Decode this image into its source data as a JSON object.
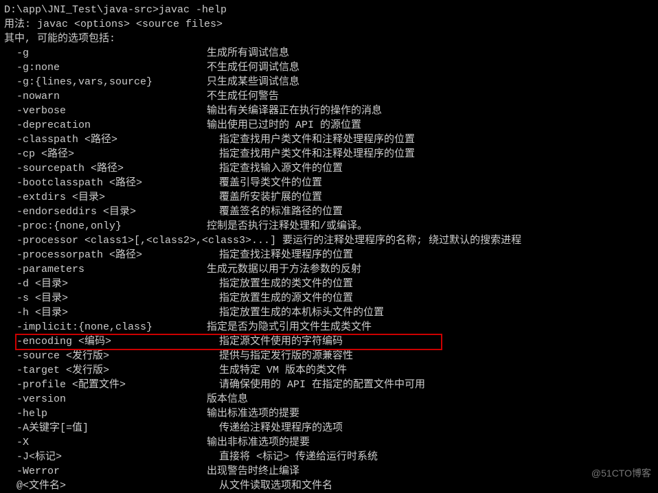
{
  "prompt": "D:\\app\\JNI_Test\\java-src>javac -help",
  "usage": "用法: javac <options> <source files>",
  "possible": "其中, 可能的选项包括:",
  "options": [
    {
      "flag": "  -g",
      "desc": "生成所有调试信息"
    },
    {
      "flag": "  -g:none",
      "desc": "不生成任何调试信息"
    },
    {
      "flag": "  -g:{lines,vars,source}",
      "desc": "只生成某些调试信息"
    },
    {
      "flag": "  -nowarn",
      "desc": "不生成任何警告"
    },
    {
      "flag": "  -verbose",
      "desc": "输出有关编译器正在执行的操作的消息"
    },
    {
      "flag": "  -deprecation",
      "desc": "输出使用已过时的 API 的源位置"
    },
    {
      "flag": "  -classpath <路径>",
      "desc": "  指定查找用户类文件和注释处理程序的位置"
    },
    {
      "flag": "  -cp <路径>",
      "desc": "  指定查找用户类文件和注释处理程序的位置"
    },
    {
      "flag": "  -sourcepath <路径>",
      "desc": "  指定查找输入源文件的位置"
    },
    {
      "flag": "  -bootclasspath <路径>",
      "desc": "  覆盖引导类文件的位置"
    },
    {
      "flag": "  -extdirs <目录>",
      "desc": "  覆盖所安装扩展的位置"
    },
    {
      "flag": "  -endorseddirs <目录>",
      "desc": "  覆盖签名的标准路径的位置"
    },
    {
      "flag": "  -proc:{none,only}",
      "desc": "控制是否执行注释处理和/或编译。"
    },
    {
      "flag": "  -processor <class1>[,<class2>,<class3>...] 要运行的注释处理程序的名称; 绕过默认的搜索进程",
      "desc": ""
    },
    {
      "flag": "  -processorpath <路径>",
      "desc": "  指定查找注释处理程序的位置"
    },
    {
      "flag": "  -parameters",
      "desc": "生成元数据以用于方法参数的反射"
    },
    {
      "flag": "  -d <目录>",
      "desc": "  指定放置生成的类文件的位置"
    },
    {
      "flag": "  -s <目录>",
      "desc": "  指定放置生成的源文件的位置"
    },
    {
      "flag": "  -h <目录>",
      "desc": "  指定放置生成的本机标头文件的位置"
    },
    {
      "flag": "  -implicit:{none,class}",
      "desc": "指定是否为隐式引用文件生成类文件"
    },
    {
      "flag": "  -encoding <编码>",
      "desc": "  指定源文件使用的字符编码"
    },
    {
      "flag": "  -source <发行版>",
      "desc": "  提供与指定发行版的源兼容性"
    },
    {
      "flag": "  -target <发行版>",
      "desc": "  生成特定 VM 版本的类文件"
    },
    {
      "flag": "  -profile <配置文件>",
      "desc": "  请确保使用的 API 在指定的配置文件中可用"
    },
    {
      "flag": "  -version",
      "desc": "版本信息"
    },
    {
      "flag": "  -help",
      "desc": "输出标准选项的提要"
    },
    {
      "flag": "  -A关键字[=值]",
      "desc": "  传递给注释处理程序的选项"
    },
    {
      "flag": "  -X",
      "desc": "输出非标准选项的提要"
    },
    {
      "flag": "  -J<标记>",
      "desc": "  直接将 <标记> 传递给运行时系统"
    },
    {
      "flag": "  -Werror",
      "desc": "出现警告时终止编译"
    },
    {
      "flag": "  @<文件名>",
      "desc": "  从文件读取选项和文件名"
    }
  ],
  "highlight_index": 20,
  "watermark": "@51CTO博客"
}
